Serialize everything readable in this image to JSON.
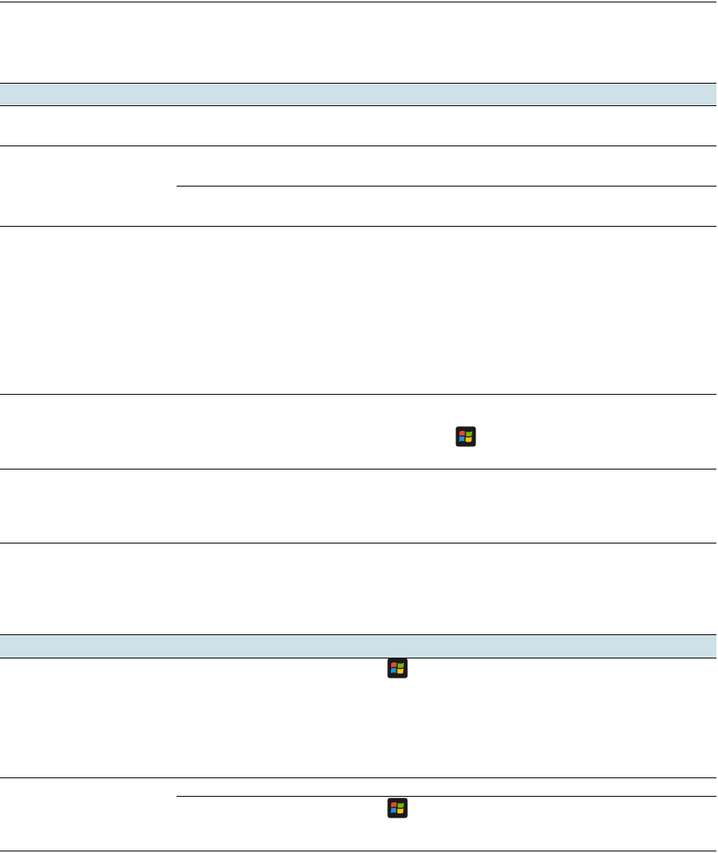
{
  "page": {
    "background": "#ffffff",
    "rule_color": "#000000",
    "header_band_color": "#cfe1e8"
  },
  "tables": [
    {
      "header": "",
      "rows": [
        {
          "label": "",
          "cells": [
            ""
          ]
        },
        {
          "label": "",
          "cells": [
            "",
            ""
          ]
        },
        {
          "label": "",
          "cells": [
            ""
          ]
        },
        {
          "label": "",
          "cells": [
            ""
          ],
          "icons": [
            "windows-start-icon"
          ]
        },
        {
          "label": "",
          "cells": [
            ""
          ]
        }
      ]
    },
    {
      "header": "",
      "rows": [
        {
          "label": "",
          "cells": [
            ""
          ],
          "icons": [
            "windows-start-icon"
          ]
        },
        {
          "label": "",
          "cells": [
            "",
            ""
          ],
          "icons": [
            "windows-start-icon"
          ]
        }
      ]
    }
  ],
  "icons": {
    "windows_start": {
      "name": "windows-start-icon",
      "colors": [
        "#e8492f",
        "#7ab800",
        "#1e90d8",
        "#ffc20e"
      ],
      "frame": "#1a1a1a"
    }
  }
}
